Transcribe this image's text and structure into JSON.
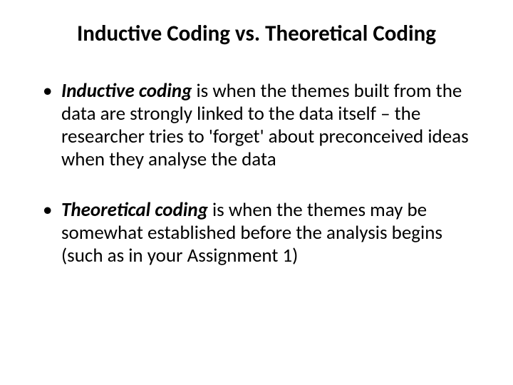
{
  "title": "Inductive Coding vs. Theoretical Coding",
  "bullets": [
    {
      "term": "Inductive coding",
      "rest": " is when the themes built from the data are strongly linked to the data itself – the researcher tries to 'forget' about preconceived ideas when they analyse the data"
    },
    {
      "term": "Theoretical coding",
      "rest": " is when the themes may be somewhat established before the analysis begins (such as in your Assignment 1)"
    }
  ]
}
